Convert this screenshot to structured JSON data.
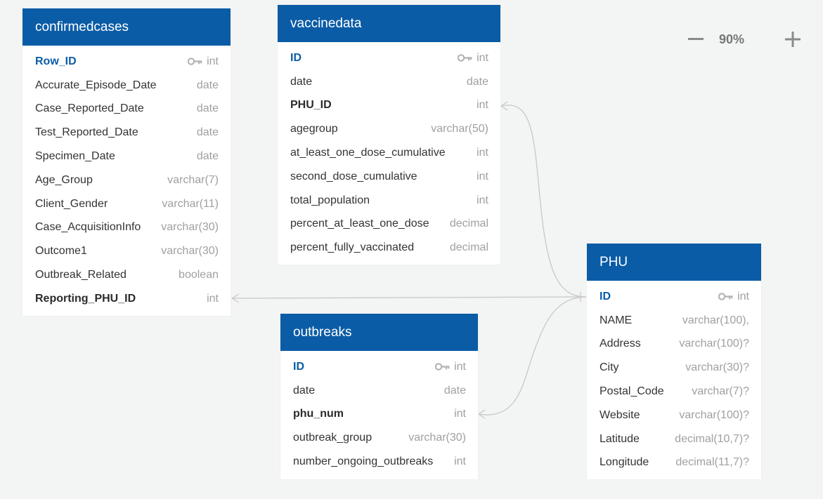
{
  "zoom": {
    "level": "90%",
    "minus_icon": "minus-icon",
    "plus_icon": "plus-icon"
  },
  "colors": {
    "header": "#0b5ca6",
    "pk": "#0b5ca6",
    "type": "#a0a0a0",
    "line": "#c8c8c8",
    "background": "#f3f4f4"
  },
  "tables": {
    "confirmedcases": {
      "title": "confirmedcases",
      "columns": [
        {
          "name": "Row_ID",
          "type": "int",
          "pk": true
        },
        {
          "name": "Accurate_Episode_Date",
          "type": "date"
        },
        {
          "name": "Case_Reported_Date",
          "type": "date"
        },
        {
          "name": "Test_Reported_Date",
          "type": "date"
        },
        {
          "name": "Specimen_Date",
          "type": "date"
        },
        {
          "name": "Age_Group",
          "type": "varchar(7)"
        },
        {
          "name": "Client_Gender",
          "type": "varchar(11)"
        },
        {
          "name": "Case_AcquisitionInfo",
          "type": "varchar(30)"
        },
        {
          "name": "Outcome1",
          "type": "varchar(30)"
        },
        {
          "name": "Outbreak_Related",
          "type": "boolean"
        },
        {
          "name": "Reporting_PHU_ID",
          "type": "int",
          "fk": true
        }
      ]
    },
    "vaccinedata": {
      "title": "vaccinedata",
      "columns": [
        {
          "name": "ID",
          "type": "int",
          "pk": true
        },
        {
          "name": "date",
          "type": "date"
        },
        {
          "name": "PHU_ID",
          "type": "int",
          "fk": true
        },
        {
          "name": "agegroup",
          "type": "varchar(50)"
        },
        {
          "name": "at_least_one_dose_cumulative",
          "type": "int"
        },
        {
          "name": "second_dose_cumulative",
          "type": "int"
        },
        {
          "name": "total_population",
          "type": "int"
        },
        {
          "name": "percent_at_least_one_dose",
          "type": "decimal"
        },
        {
          "name": "percent_fully_vaccinated",
          "type": "decimal"
        }
      ]
    },
    "outbreaks": {
      "title": "outbreaks",
      "columns": [
        {
          "name": "ID",
          "type": "int",
          "pk": true
        },
        {
          "name": "date",
          "type": "date"
        },
        {
          "name": "phu_num",
          "type": "int",
          "fk": true
        },
        {
          "name": "outbreak_group",
          "type": "varchar(30)"
        },
        {
          "name": "number_ongoing_outbreaks",
          "type": "int"
        }
      ]
    },
    "PHU": {
      "title": "PHU",
      "columns": [
        {
          "name": "ID",
          "type": "int",
          "pk": true
        },
        {
          "name": "NAME",
          "type": "varchar(100),"
        },
        {
          "name": "Address",
          "type": "varchar(100)?"
        },
        {
          "name": "City",
          "type": "varchar(30)?"
        },
        {
          "name": "Postal_Code",
          "type": "varchar(7)?"
        },
        {
          "name": "Website",
          "type": "varchar(100)?"
        },
        {
          "name": "Latitude",
          "type": "decimal(10,7)?"
        },
        {
          "name": "Longitude",
          "type": "decimal(11,7)?"
        }
      ]
    }
  }
}
